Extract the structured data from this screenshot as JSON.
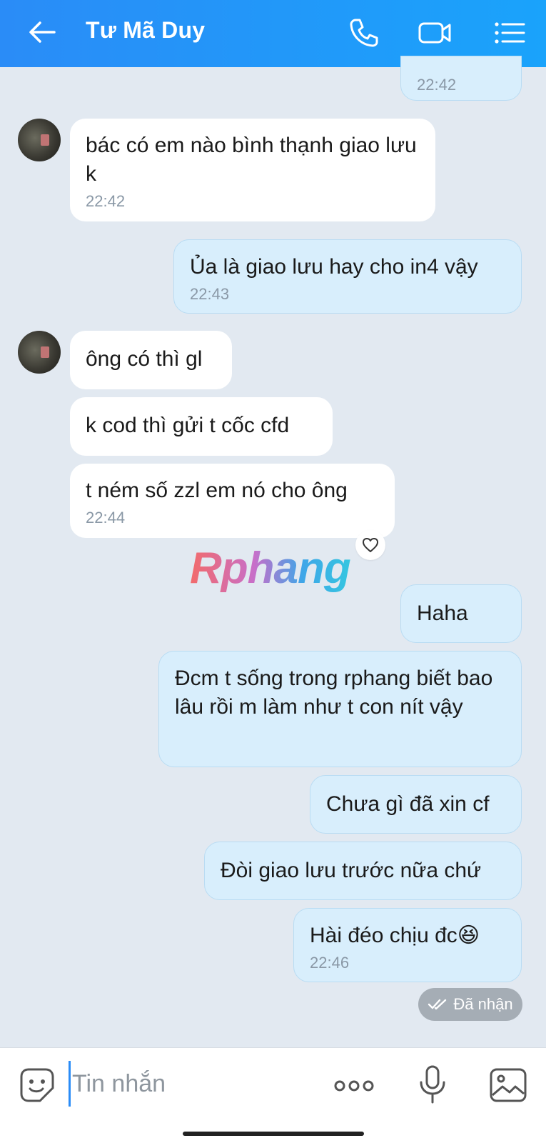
{
  "header": {
    "title": "Tư Mã Duy",
    "back_icon": "arrow-left-icon",
    "call_icon": "phone-icon",
    "video_icon": "video-camera-icon",
    "menu_icon": "list-menu-icon"
  },
  "messages": [
    {
      "from": "me",
      "text": "",
      "time": "22:42"
    },
    {
      "from": "other",
      "text": "bác có em nào bình thạnh giao lưu k",
      "time": "22:42"
    },
    {
      "from": "me",
      "text": "Ủa là giao lưu hay cho in4 vậy",
      "time": "22:43"
    },
    {
      "from": "other",
      "text": "ông có thì gl",
      "time": ""
    },
    {
      "from": "other",
      "text": "k cod thì gửi t cốc cfd",
      "time": ""
    },
    {
      "from": "other",
      "text": "t ném số zzl em nó cho ông",
      "time": "22:44"
    },
    {
      "from": "me",
      "text": "Haha",
      "time": ""
    },
    {
      "from": "me",
      "text": "Đcm t sống trong rphang biết bao lâu rồi m làm như t con nít vậy",
      "time": ""
    },
    {
      "from": "me",
      "text": "Chưa gì đã xin cf",
      "time": ""
    },
    {
      "from": "me",
      "text": "Đòi giao lưu trước nữa chứ",
      "time": ""
    },
    {
      "from": "me",
      "text": "Hài đéo chịu đc😆",
      "time": "22:46"
    }
  ],
  "watermark": "Rphang",
  "status": {
    "label": "Đã nhận",
    "icon": "double-check-icon"
  },
  "composer": {
    "placeholder": "Tin nhắn",
    "emoji_icon": "sticker-smile-icon",
    "more_icon": "more-dots-icon",
    "mic_icon": "microphone-icon",
    "image_icon": "image-icon"
  },
  "colors": {
    "header": "#2a8cf7",
    "background": "#e2e9f1",
    "outgoing_bubble": "#d8eefc",
    "incoming_bubble": "#ffffff"
  }
}
